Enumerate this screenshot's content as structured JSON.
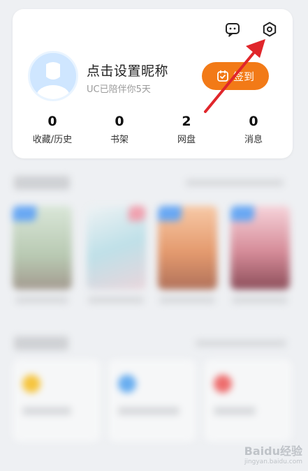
{
  "profile": {
    "nickname": "点击设置昵称",
    "subtitle": "UC已陪伴你5天",
    "checkin_label": "签到"
  },
  "stats": [
    {
      "value": "0",
      "label": "收藏/历史"
    },
    {
      "value": "0",
      "label": "书架"
    },
    {
      "value": "2",
      "label": "网盘"
    },
    {
      "value": "0",
      "label": "消息"
    }
  ],
  "icons": {
    "message": "message-icon",
    "settings": "gear-icon",
    "checkin": "calendar-check-icon"
  },
  "colors": {
    "accent": "#f27a17",
    "annotation_arrow": "#e0262b"
  },
  "watermark": {
    "text": "Baidu经验",
    "url": "jingyan.baidu.com"
  }
}
